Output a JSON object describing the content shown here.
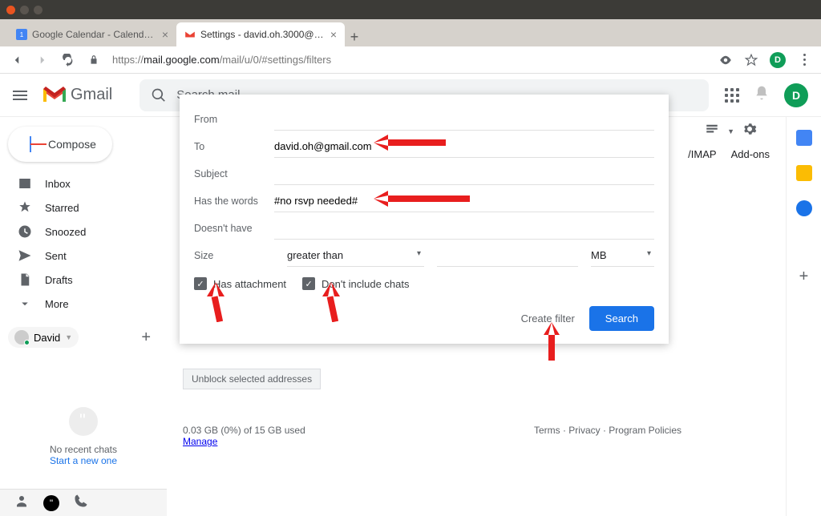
{
  "browser": {
    "tab1_title": "Google Calendar - Calendar sett",
    "tab2_title": "Settings - david.oh.3000@gma",
    "url_prefix": "https://",
    "url_domain": "mail.google.com",
    "url_path": "/mail/u/0/#settings/filters",
    "avatar_letter": "D"
  },
  "gmail": {
    "product_name": "Gmail",
    "search_placeholder": "Search mail",
    "compose": "Compose",
    "nav": {
      "inbox": "Inbox",
      "starred": "Starred",
      "snoozed": "Snoozed",
      "sent": "Sent",
      "drafts": "Drafts",
      "more": "More"
    },
    "user_name": "David",
    "no_chats": "No recent chats",
    "start_chat": "Start a new one"
  },
  "settings_tabs": {
    "imap": "/IMAP",
    "addons": "Add-ons"
  },
  "unblock_btn": "Unblock selected addresses",
  "footer": {
    "storage": "0.03 GB (0%) of 15 GB used",
    "manage": "Manage",
    "terms": "Terms",
    "privacy": "Privacy",
    "policies": "Program Policies"
  },
  "filter": {
    "from": "From",
    "to": "To",
    "to_value": "david.oh@gmail.com",
    "subject": "Subject",
    "has_words": "Has the words",
    "has_words_value": "#no rsvp needed#",
    "doesnt_have": "Doesn't have",
    "size": "Size",
    "size_op": "greater than",
    "size_unit": "MB",
    "has_attachment": "Has attachment",
    "no_chats": "Don't include chats",
    "create_filter": "Create filter",
    "search": "Search"
  }
}
